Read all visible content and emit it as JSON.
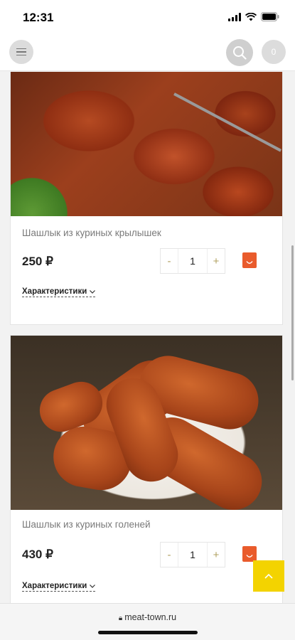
{
  "status_bar": {
    "time": "12:31"
  },
  "header": {
    "cart_count": "0"
  },
  "products": [
    {
      "title": "Шашлык из куриных крылышек",
      "price": "250 ₽",
      "quantity": "1",
      "minus": "-",
      "plus": "+",
      "specs_label": "Характеристики"
    },
    {
      "title": "Шашлык из куриных голеней",
      "price": "430 ₽",
      "quantity": "1",
      "minus": "-",
      "plus": "+",
      "specs_label": "Характеристики"
    }
  ],
  "browser": {
    "url": "meat-town.ru"
  },
  "colors": {
    "accent": "#f3d300",
    "cart_button": "#e95b2c"
  },
  "icons": [
    "menu-icon",
    "search-icon",
    "cart-icon",
    "shopping-bag-icon",
    "chevron-down-icon",
    "chevron-up-icon",
    "lock-icon",
    "signal-icon",
    "wifi-icon",
    "battery-icon"
  ]
}
